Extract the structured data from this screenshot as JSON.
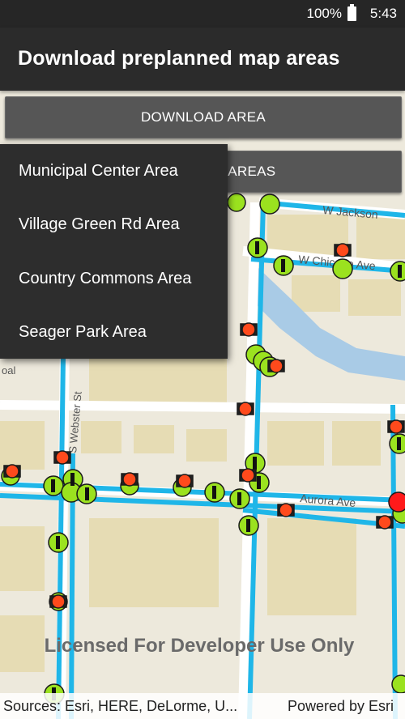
{
  "status_bar": {
    "battery": "100%",
    "time": "5:43"
  },
  "app_bar": {
    "title": "Download preplanned map areas"
  },
  "buttons": {
    "download_area": "DOWNLOAD AREA",
    "delete_areas": "DELETE ALL AREAS",
    "delete_areas_visible": "E AREAS"
  },
  "dropdown": {
    "items": [
      {
        "label": "Municipal Center Area"
      },
      {
        "label": "Village Green Rd Area"
      },
      {
        "label": "Country Commons Area"
      },
      {
        "label": "Seager Park Area"
      }
    ]
  },
  "map": {
    "street_labels": [
      "W Jackson",
      "W Chicago Ave",
      "S Webster St",
      "Aurora Ave",
      "oal"
    ],
    "watermark": "Licensed For Developer Use Only",
    "attribution": "Sources: Esri, HERE, DeLorme, U...",
    "powered_by": "Powered by Esri",
    "colors": {
      "pipe": "#1fb6e8",
      "valve": "#9be21f",
      "hydrant": "#ff4a1c",
      "water": "#a9cbe6"
    }
  }
}
